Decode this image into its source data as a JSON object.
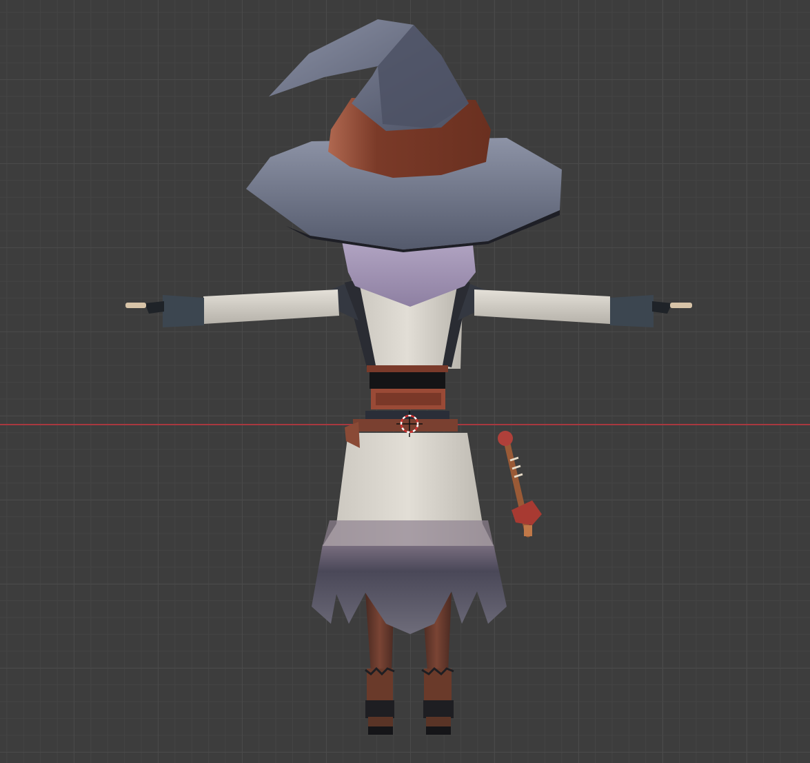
{
  "viewport": {
    "view": "3d-viewport",
    "grid": true,
    "x_axis_color": "#a8383f"
  },
  "scene": {
    "object": "witch-character-t-pose",
    "colors": {
      "hat": "#5a5f72",
      "hat_band": "#7a3a28",
      "hair": "#a596b8",
      "dress": "#d8d4cc",
      "skirt_trim": "#50505e",
      "glove": "#3c4650",
      "belt": "#8a3e2e",
      "wand_tip": "#a83a32",
      "boots": "#5a3426"
    }
  }
}
